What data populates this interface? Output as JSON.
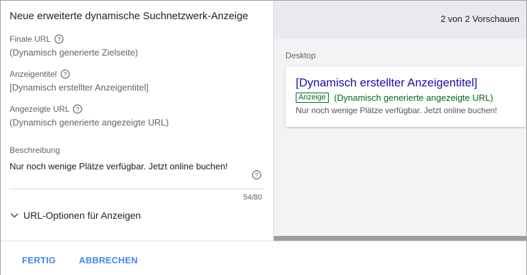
{
  "editor": {
    "title": "Neue erweiterte dynamische Suchnetzwerk-Anzeige",
    "final_url": {
      "label": "Finale URL",
      "value": "(Dynamisch generierte Zielseite)"
    },
    "headline": {
      "label": "Anzeigentitel",
      "value": "[Dynamisch erstellter Anzeigentitel]"
    },
    "display_url": {
      "label": "Angezeigte URL",
      "value": "(Dynamisch generierte angezeigte URL)"
    },
    "description": {
      "label": "Beschreibung",
      "value": "Nur noch wenige Plätze verfügbar. Jetzt online buchen!",
      "counter": "54/80"
    },
    "url_options": "URL-Optionen für Anzeigen"
  },
  "preview": {
    "count": "2 von 2 Vorschauen",
    "device_label": "Desktop",
    "ad": {
      "title": "[Dynamisch erstellter Anzeigentitel]",
      "badge": "Anzeige",
      "url": "(Dynamisch generierte angezeigte URL)",
      "description": "Nur noch wenige Plätze verfügbar. Jetzt online buchen!"
    }
  },
  "footer": {
    "done": "FERTIG",
    "cancel": "ABBRECHEN"
  },
  "icons": {
    "help": "help-circle-icon",
    "expand": "chevron-down-icon"
  },
  "colors": {
    "link": "#1a0dab",
    "url_green": "#006621",
    "button_blue": "#4285f4"
  }
}
